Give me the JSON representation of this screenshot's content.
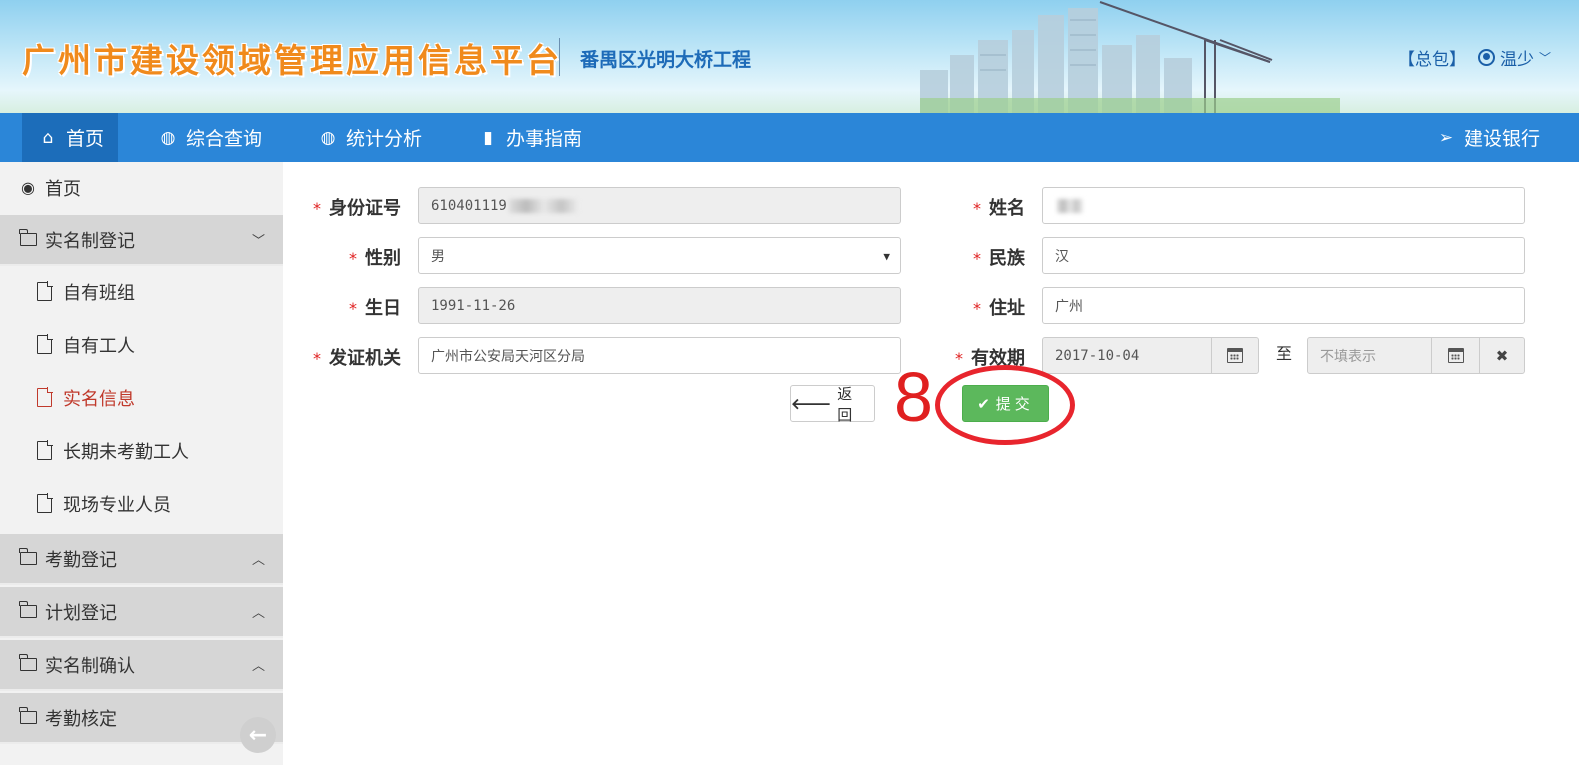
{
  "header": {
    "app_title": "广州市建设领域管理应用信息平台",
    "project_name": "番禺区光明大桥工程",
    "role_label": "【总包】",
    "user_name": "温少",
    "user_chevron": "﹀"
  },
  "nav": {
    "items": [
      {
        "label": "首页",
        "icon": "home-icon"
      },
      {
        "label": "综合查询",
        "icon": "globe-icon"
      },
      {
        "label": "统计分析",
        "icon": "globe-icon"
      },
      {
        "label": "办事指南",
        "icon": "book-icon"
      }
    ],
    "right_item": {
      "label": "建设银行",
      "icon": "send-icon"
    }
  },
  "sidebar": {
    "home": "首页",
    "group_realname": "实名制登记",
    "sub_items": [
      "自有班组",
      "自有工人",
      "实名信息",
      "长期未考勤工人",
      "现场专业人员"
    ],
    "active_sub": "实名信息",
    "groups": [
      "考勤登记",
      "计划登记",
      "实名制确认",
      "考勤核定"
    ]
  },
  "form": {
    "required_mark": "*",
    "id_label": "身份证号",
    "id_value": "610401119",
    "name_label": "姓名",
    "name_value": "",
    "gender_label": "性别",
    "gender_value": "男",
    "ethnic_label": "民族",
    "ethnic_value": "汉",
    "birth_label": "生日",
    "birth_value": "1991-11-26",
    "address_label": "住址",
    "address_value": "广州",
    "issuer_label": "发证机关",
    "issuer_value": "广州市公安局天河区分局",
    "valid_label": "有效期",
    "valid_start": "2017-10-04",
    "valid_to": "至",
    "valid_end_placeholder": "不填表示",
    "back_button": "返回",
    "submit_button": "提交"
  },
  "annotation": {
    "step_number": "8",
    "highlight_color": "#e8252d"
  },
  "colors": {
    "nav_bg": "#2b86d8",
    "nav_active": "#1c6dba",
    "submit_green": "#5cb85c",
    "active_red": "#c0392b"
  }
}
